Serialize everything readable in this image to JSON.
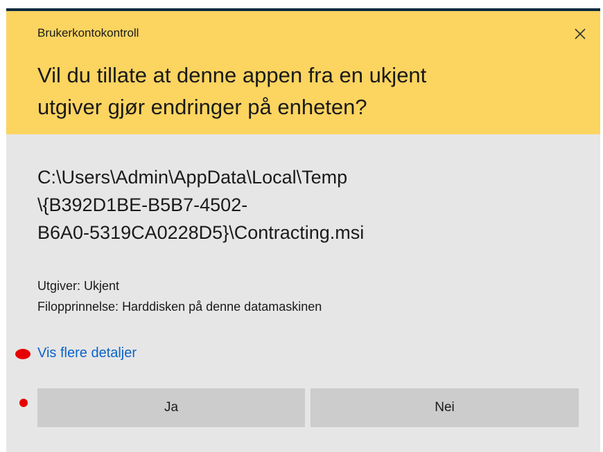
{
  "dialog": {
    "app_title": "Brukerkontokontroll",
    "question_lines": [
      "Vil du tillate at denne appen fra en ukjent",
      "utgiver gjør endringer på enheten?"
    ],
    "path_lines": [
      "C:\\Users\\Admin\\AppData\\Local\\Temp",
      "\\{B392D1BE-B5B7-4502-",
      "B6A0-5319CA0228D5}\\Contracting.msi"
    ],
    "publisher": "Utgiver: Ukjent",
    "origin": "Filopprinnelse: Harddisken på denne datamaskinen",
    "details_link": "Vis flere detaljer",
    "yes_label": "Ja",
    "no_label": "Nei",
    "close_icon": "close-icon"
  },
  "colors": {
    "header_bg": "#fcd460",
    "body_bg": "#e6e6e6",
    "button_bg": "#cccccc",
    "link": "#0a64c8",
    "annotation_dot": "#e60000",
    "top_border": "#0e2a3f"
  }
}
